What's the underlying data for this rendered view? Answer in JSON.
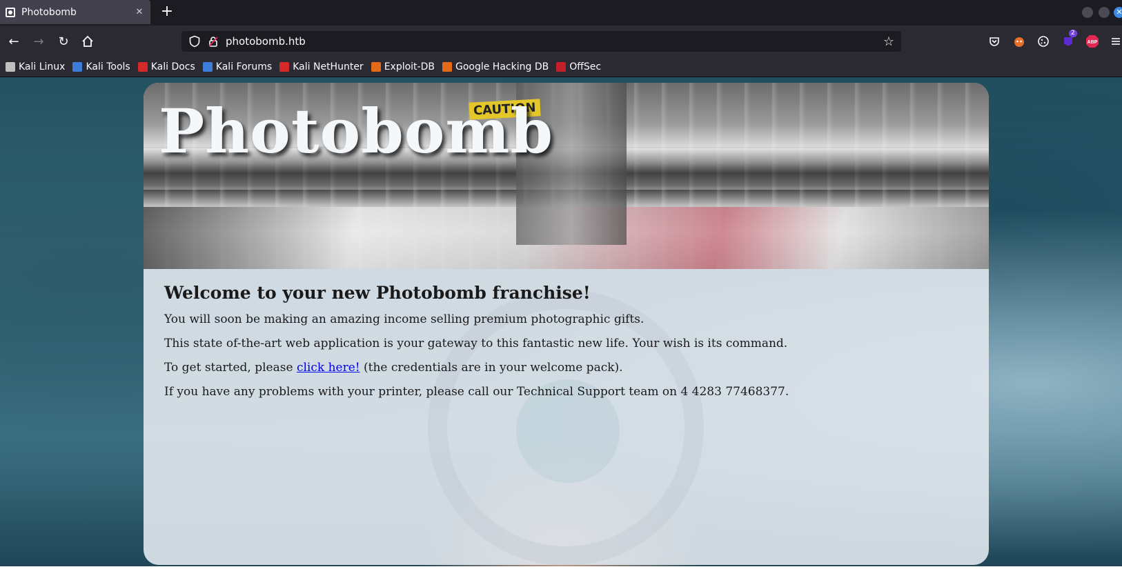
{
  "browser": {
    "tab": {
      "title": "Photobomb",
      "favicon": "camera-icon",
      "close_icon": "close-icon"
    },
    "new_tab_icon": "plus-icon",
    "url": "photobomb.htb",
    "nav": {
      "back_icon": "arrow-left-icon",
      "forward_icon": "arrow-right-icon",
      "reload_icon": "reload-icon",
      "home_icon": "home-icon"
    },
    "extensions": [
      {
        "name": "pocket-icon",
        "glyph": "◘"
      },
      {
        "name": "foxyproxy-icon",
        "glyph": "🦊"
      },
      {
        "name": "cookie-icon",
        "glyph": "⚙"
      },
      {
        "name": "extension-badge-icon",
        "glyph": "◆",
        "badge": "2"
      },
      {
        "name": "adblock-icon",
        "glyph": "ABP"
      },
      {
        "name": "menu-icon",
        "glyph": "≡"
      }
    ],
    "bookmarks": [
      {
        "label": "Kali Linux",
        "color": "#c0c0c0"
      },
      {
        "label": "Kali Tools",
        "color": "#3b7dd8"
      },
      {
        "label": "Kali Docs",
        "color": "#d42a2a"
      },
      {
        "label": "Kali Forums",
        "color": "#3b7dd8"
      },
      {
        "label": "Kali NetHunter",
        "color": "#d42a2a"
      },
      {
        "label": "Exploit-DB",
        "color": "#e46a1a"
      },
      {
        "label": "Google Hacking DB",
        "color": "#e46a1a"
      },
      {
        "label": "OffSec",
        "color": "#c4202a"
      }
    ]
  },
  "page": {
    "hero_title": "Photobomb",
    "hero_sign": "CAUTION",
    "heading": "Welcome to your new Photobomb franchise!",
    "para1": "You will soon be making an amazing income selling premium photographic gifts.",
    "para2": "This state of-the-art web application is your gateway to this fantastic new life. Your wish is its command.",
    "para3_before": "To get started, please ",
    "para3_link": "click here!",
    "para3_after": " (the credentials are in your welcome pack).",
    "para4": "If you have any problems with your printer, please call our Technical Support team on 4 4283 77468377."
  }
}
